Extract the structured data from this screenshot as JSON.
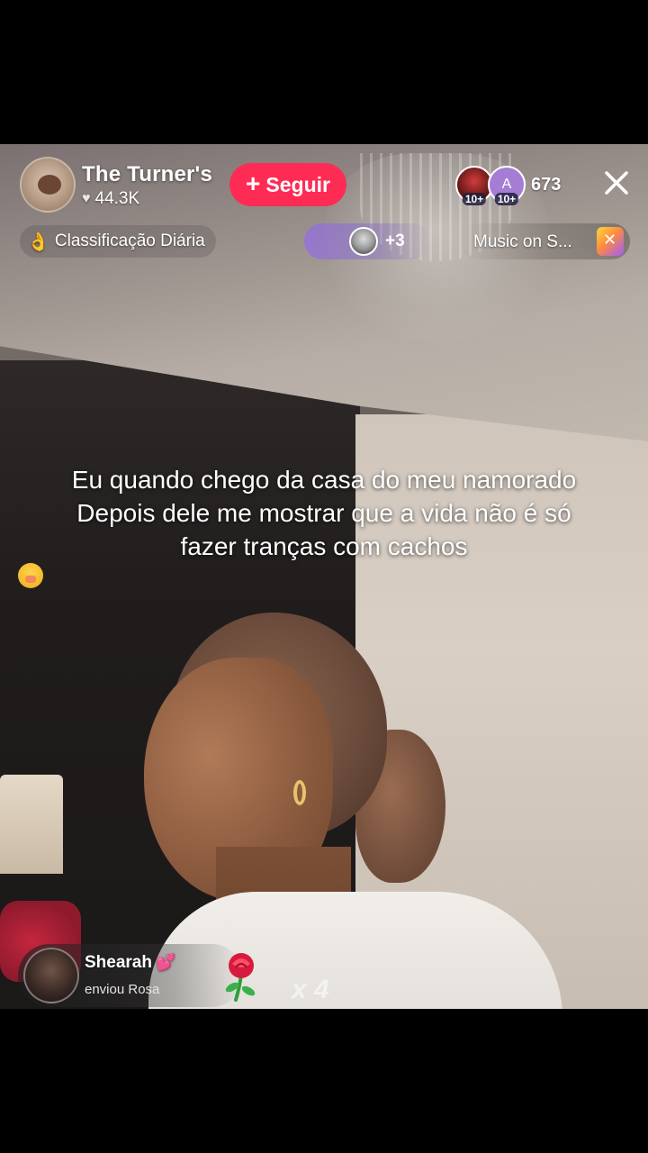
{
  "host": {
    "name": "The Turner's",
    "likes": "44.3K",
    "follow_label": "Seguir"
  },
  "viewers": {
    "badge1": "10+",
    "badge2": "10+",
    "avatar2_letter": "A",
    "count": "673"
  },
  "ranking": {
    "label": "Classificação Diária"
  },
  "guests": {
    "count": "+3"
  },
  "music": {
    "label": "Music on S..."
  },
  "caption": {
    "line1": "Eu quando chego da casa do meu namorado",
    "line2": "Depois dele me mostrar que a vida não é só",
    "line3": "fazer tranças com cachos"
  },
  "gift": {
    "sender": "Shearah",
    "action": "enviou Rosa",
    "count": "x 4"
  },
  "colors": {
    "follow": "#fe2c55",
    "guests_pill": "#9a6ee6",
    "gift_heart": "#ff5ca8"
  },
  "icons": [
    "heart-icon",
    "plus-icon",
    "close-icon",
    "flame-icon",
    "music-box-icon",
    "emoji-icon",
    "gift-heart-icon",
    "rose-icon"
  ]
}
